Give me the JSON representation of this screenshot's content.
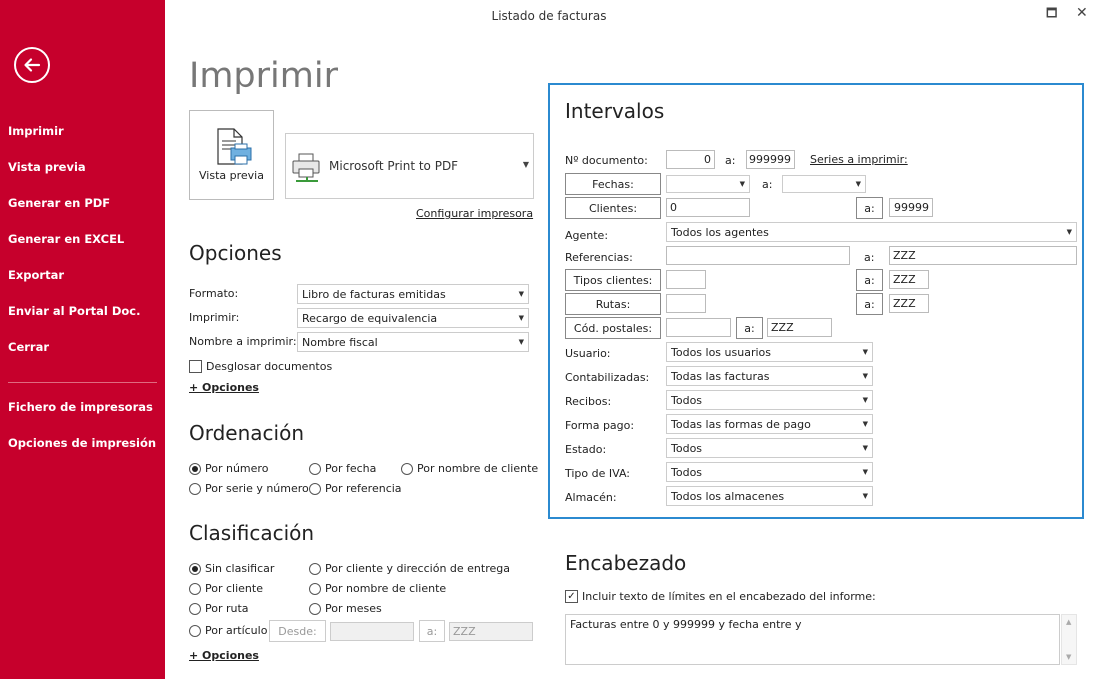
{
  "window": {
    "title": "Listado de facturas",
    "maximize_glyph": "🗖",
    "close_glyph": "✕"
  },
  "sidebar": {
    "items": [
      {
        "label": "Imprimir"
      },
      {
        "label": "Vista previa"
      },
      {
        "label": "Generar en PDF"
      },
      {
        "label": "Generar en EXCEL"
      },
      {
        "label": "Exportar"
      },
      {
        "label": "Enviar al Portal Doc."
      },
      {
        "label": "Cerrar"
      },
      {
        "label": "Fichero de impresoras"
      },
      {
        "label": "Opciones de impresión"
      }
    ]
  },
  "main": {
    "heading": "Imprimir",
    "preview_label": "Vista previa",
    "printer": "Microsoft Print to PDF",
    "configure_link": "Configurar impresora"
  },
  "opciones": {
    "title": "Opciones",
    "formato_label": "Formato:",
    "formato_value": "Libro de facturas emitidas",
    "imprimir_label": "Imprimir:",
    "imprimir_value": "Recargo de equivalencia",
    "nombre_label": "Nombre a imprimir:",
    "nombre_value": "Nombre fiscal",
    "desglosar_label": "Desglosar documentos",
    "mas_opciones": "+ Opciones"
  },
  "ordenacion": {
    "title": "Ordenación",
    "options": [
      "Por número",
      "Por fecha",
      "Por nombre de cliente",
      "Por serie y número",
      "Por referencia"
    ]
  },
  "clasificacion": {
    "title": "Clasificación",
    "options": [
      "Sin clasificar",
      "Por cliente y dirección de entrega",
      "Por cliente",
      "Por nombre de cliente",
      "Por ruta",
      "Por meses",
      "Por artículo"
    ],
    "desde_label": "Desde:",
    "desde_value": "",
    "a_label": "a:",
    "a_value": "ZZZ",
    "mas_opciones": "+ Opciones"
  },
  "intervalos": {
    "title": "Intervalos",
    "documento_label": "Nº documento:",
    "documento_from": "0",
    "a_label": "a:",
    "documento_to": "999999",
    "series_link": "Series a imprimir:",
    "fechas_label": "Fechas:",
    "clientes_label": "Clientes:",
    "clientes_from": "0",
    "clientes_to": "99999",
    "agente_label": "Agente:",
    "agente_value": "Todos los agentes",
    "referencias_label": "Referencias:",
    "referencias_to": "ZZZ",
    "tipos_clientes_label": "Tipos clientes:",
    "tipos_clientes_to": "ZZZ",
    "rutas_label": "Rutas:",
    "rutas_to": "ZZZ",
    "cod_postales_label": "Cód. postales:",
    "cod_postales_to": "ZZZ",
    "usuario_label": "Usuario:",
    "usuario_value": "Todos los usuarios",
    "contabilizadas_label": "Contabilizadas:",
    "contabilizadas_value": "Todas las facturas",
    "recibos_label": "Recibos:",
    "recibos_value": "Todos",
    "forma_pago_label": "Forma pago:",
    "forma_pago_value": "Todas las formas de pago",
    "estado_label": "Estado:",
    "estado_value": "Todos",
    "tipo_iva_label": "Tipo de IVA:",
    "tipo_iva_value": "Todos",
    "almacen_label": "Almacén:",
    "almacen_value": "Todos los almacenes"
  },
  "encabezado": {
    "title": "Encabezado",
    "checkbox_label": "Incluir texto de límites en el encabezado del informe:",
    "text": "Facturas entre 0 y 999999 y fecha entre  y"
  },
  "colors": {
    "sidebar": "#c6002c",
    "accent_border": "#2b8ad0"
  }
}
